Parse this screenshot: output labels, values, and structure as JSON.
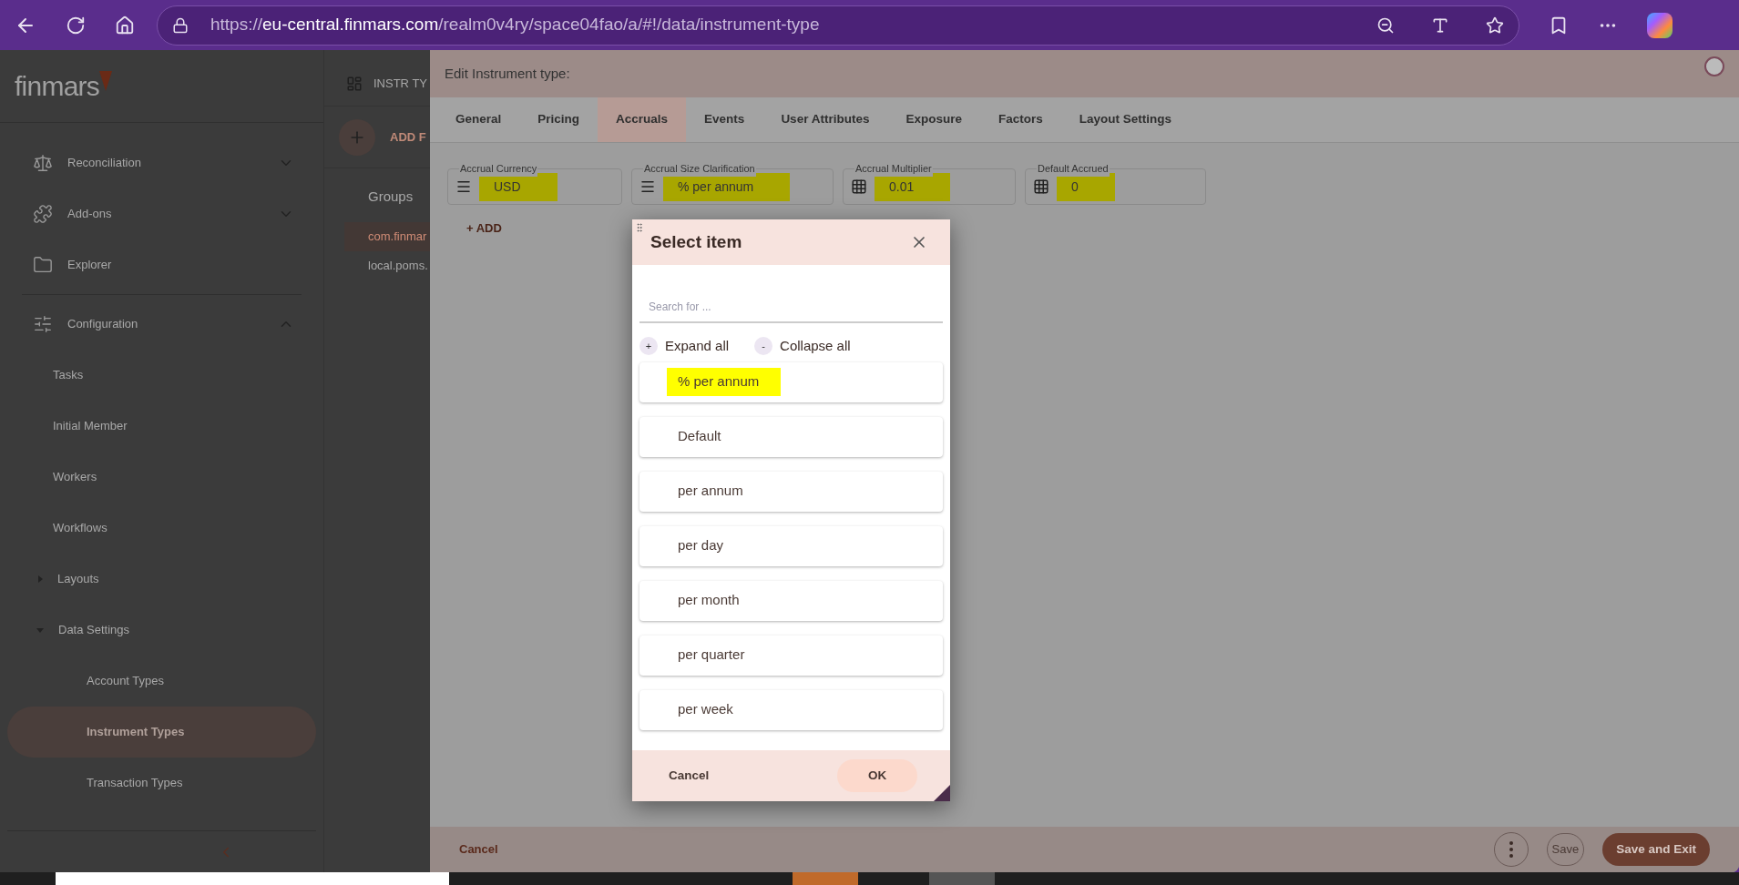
{
  "browser": {
    "url_scheme": "https://",
    "url_host": "eu-central.finmars.com",
    "url_path": "/realm0v4ry/space04fao/a/#!/data/instrument-type"
  },
  "sidebar": {
    "logo": "finmars",
    "items": [
      {
        "label": "Reconciliation",
        "expanded": false,
        "selected": false
      },
      {
        "label": "Add-ons",
        "expanded": false,
        "selected": false
      },
      {
        "label": "Explorer",
        "selected": false
      },
      {
        "label": "Configuration",
        "expanded": true,
        "selected": false,
        "children": [
          {
            "label": "Tasks",
            "selected": false
          },
          {
            "label": "Initial Member",
            "selected": false
          },
          {
            "label": "Workers",
            "selected": false
          },
          {
            "label": "Workflows",
            "selected": false
          },
          {
            "label": "Layouts",
            "expanded": false,
            "selected": false
          },
          {
            "label": "Data Settings",
            "expanded": true,
            "selected": false,
            "children": [
              {
                "label": "Account Types",
                "selected": false
              },
              {
                "label": "Instrument Types",
                "selected": true
              },
              {
                "label": "Transaction Types",
                "selected": false
              }
            ]
          }
        ]
      }
    ]
  },
  "list_panel": {
    "title": "INSTR TY",
    "add_label": "ADD F",
    "groups_label": "Groups",
    "groups": [
      {
        "label": "com.finmar",
        "selected": true
      },
      {
        "label": "local.poms.",
        "selected": false
      }
    ]
  },
  "editor": {
    "title": "Edit Instrument type:",
    "tabs": [
      {
        "label": "General",
        "selected": false
      },
      {
        "label": "Pricing",
        "selected": false
      },
      {
        "label": "Accruals",
        "selected": true
      },
      {
        "label": "Events",
        "selected": false
      },
      {
        "label": "User Attributes",
        "selected": false
      },
      {
        "label": "Exposure",
        "selected": false
      },
      {
        "label": "Factors",
        "selected": false
      },
      {
        "label": "Layout Settings",
        "selected": false
      }
    ],
    "fields": [
      {
        "label": "Accrual Currency",
        "value": "USD",
        "kind": "select",
        "highlighted": true
      },
      {
        "label": "Accrual Size Clarification",
        "value": "% per annum",
        "kind": "select",
        "highlighted": true
      },
      {
        "label": "Accrual Multiplier",
        "value": "0.01",
        "kind": "number",
        "highlighted": true
      },
      {
        "label": "Default Accrued",
        "value": "0",
        "kind": "number",
        "highlighted": true
      }
    ],
    "add_link": "+ ADD",
    "footer": {
      "cancel": "Cancel",
      "save": "Save",
      "save_exit": "Save and Exit"
    }
  },
  "dialog": {
    "title": "Select item",
    "search_placeholder": "Search for ...",
    "expand_sign": "+",
    "expand_label": "Expand all",
    "collapse_sign": "-",
    "collapse_label": "Collapse all",
    "items": [
      {
        "label": "% per annum",
        "highlighted": true
      },
      {
        "label": "Default",
        "highlighted": false
      },
      {
        "label": "per annum",
        "highlighted": false
      },
      {
        "label": "per day",
        "highlighted": false
      },
      {
        "label": "per month",
        "highlighted": false
      },
      {
        "label": "per quarter",
        "highlighted": false
      },
      {
        "label": "per week",
        "highlighted": false
      }
    ],
    "cancel": "Cancel",
    "ok": "OK"
  }
}
